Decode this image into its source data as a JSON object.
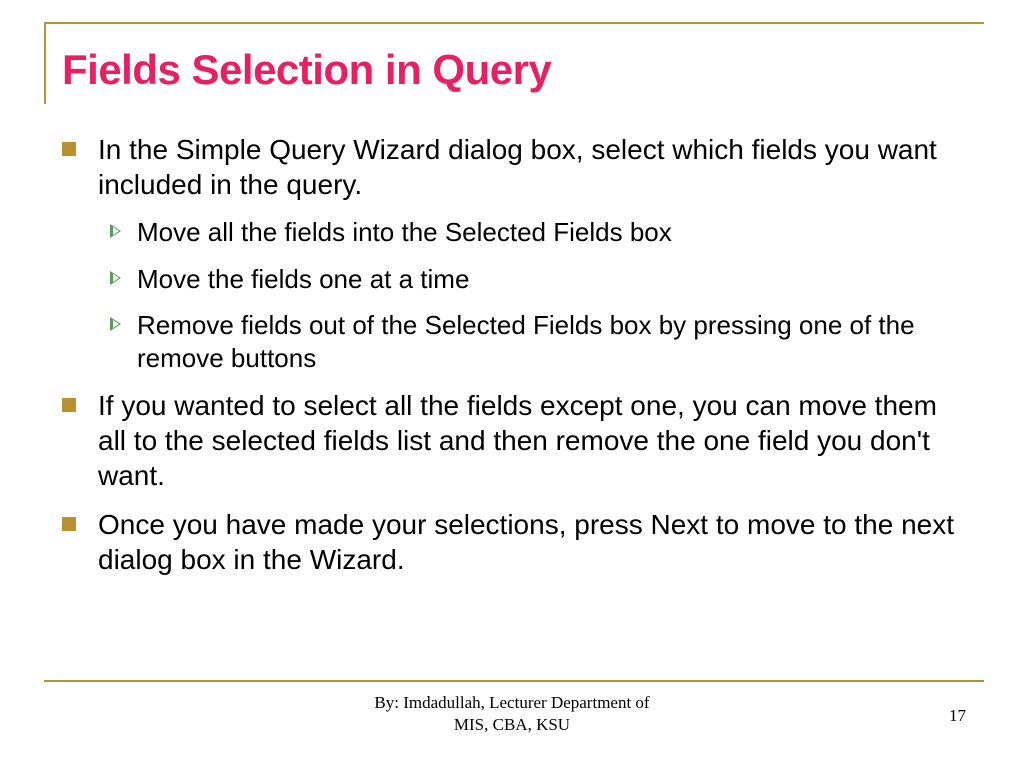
{
  "title": "Fields Selection in Query",
  "bullets": [
    {
      "text": "In the Simple Query Wizard dialog box, select which fields you want included in the query.",
      "subs": [
        "Move all the fields into the Selected Fields box",
        "Move the fields one at a time",
        "Remove fields out of the Selected Fields box by pressing one of the remove buttons"
      ]
    },
    {
      "text": "If you wanted to select all the fields except one, you can move them all to the selected fields list and then remove the one field you don't want.",
      "subs": []
    },
    {
      "text": "Once you have made your selections, press Next to move to the next dialog box in the Wizard.",
      "subs": []
    }
  ],
  "footer": {
    "line1": "By: Imdadullah, Lecturer Department of",
    "line2": "MIS, CBA, KSU"
  },
  "pageNumber": "17"
}
